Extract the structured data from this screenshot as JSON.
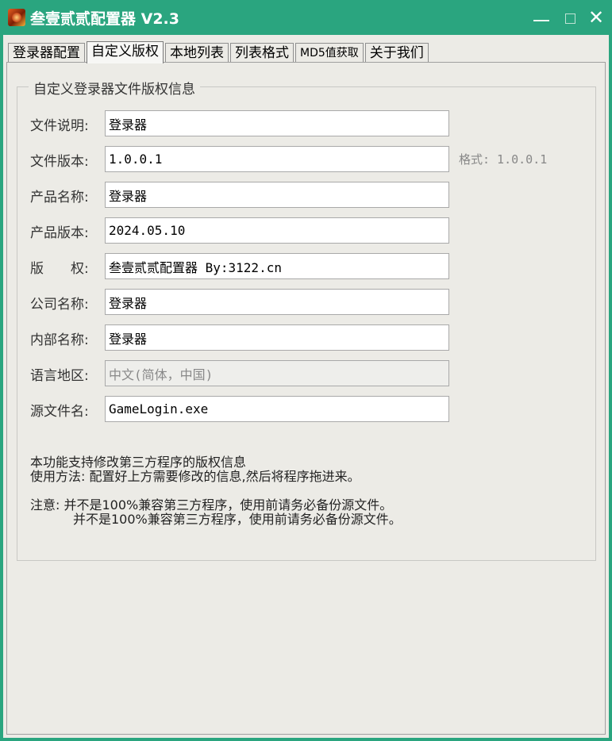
{
  "window": {
    "title": "叁壹贰贰配置器 V2.3",
    "accent_color": "#2aa57f",
    "minimize_icon": "minimize-icon",
    "maximize_icon": "maximize-icon",
    "close_icon": "close-icon",
    "close_glyph": "✕"
  },
  "tabs": [
    {
      "label": "登录器配置",
      "active": false
    },
    {
      "label": "自定义版权",
      "active": true
    },
    {
      "label": "本地列表",
      "active": false
    },
    {
      "label": "列表格式",
      "active": false
    },
    {
      "label": "MD5值获取",
      "active": false
    },
    {
      "label": "关于我们",
      "active": false
    }
  ],
  "group": {
    "title": "自定义登录器文件版权信息"
  },
  "fields": [
    {
      "label": "文件说明:",
      "value": "登录器"
    },
    {
      "label": "文件版本:",
      "value": "1.0.0.1"
    },
    {
      "label": "产品名称:",
      "value": "登录器"
    },
    {
      "label": "产品版本:",
      "value": "2024.05.10"
    },
    {
      "label": "版　　权:",
      "value": "叁壹贰贰配置器 By:3122.cn"
    },
    {
      "label": "公司名称:",
      "value": "登录器"
    },
    {
      "label": "内部名称:",
      "value": "登录器"
    },
    {
      "label": "语言地区:",
      "value": "中文(简体，中国)"
    },
    {
      "label": "源文件名:",
      "value": "GameLogin.exe"
    }
  ],
  "version_hint": "格式: 1.0.0.1",
  "notes": {
    "line1": "本功能支持修改第三方程序的版权信息",
    "line2": "使用方法: 配置好上方需要修改的信息,然后将程序拖进来。",
    "line3": "注意: 并不是100%兼容第三方程序，使用前请务必备份源文件。",
    "line4": "并不是100%兼容第三方程序，使用前请务必备份源文件。"
  }
}
